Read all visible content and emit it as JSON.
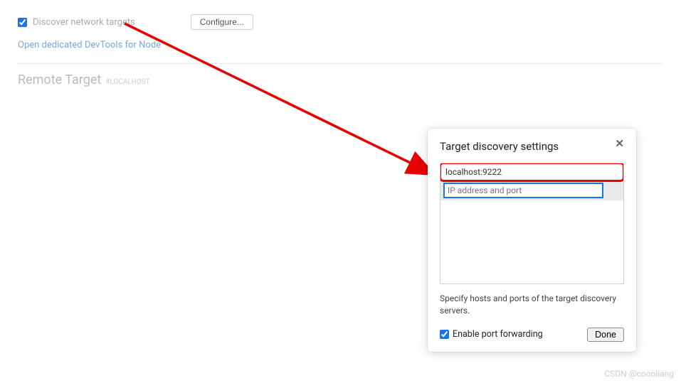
{
  "discover": {
    "checkbox_checked": true,
    "label": "Discover network targets",
    "configure_label": "Configure..."
  },
  "devtools_link": "Open dedicated DevTools for Node",
  "remote_target": {
    "title": "Remote Target",
    "sub": "#LOCALHOST"
  },
  "dialog": {
    "title": "Target discovery settings",
    "close_label": "✕",
    "hosts": [
      "localhost:9222"
    ],
    "input_placeholder": "IP address and port",
    "description": "Specify hosts and ports of the target discovery servers.",
    "port_forwarding_checked": true,
    "port_forwarding_label": "Enable port forwarding",
    "done_label": "Done"
  },
  "watermark": "CSDN @coooliang"
}
